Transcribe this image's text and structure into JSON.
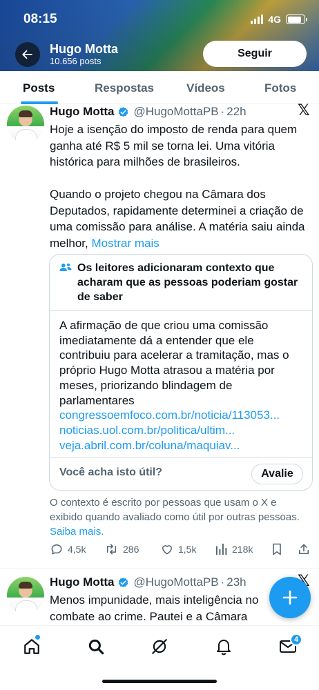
{
  "status_bar": {
    "time": "08:15",
    "network": "4G"
  },
  "profile_header": {
    "name": "Hugo Motta",
    "posts_count": "10.656 posts",
    "follow_label": "Seguir"
  },
  "tabs": [
    {
      "label": "Posts",
      "active": true
    },
    {
      "label": "Respostas",
      "active": false
    },
    {
      "label": "Vídeos",
      "active": false
    },
    {
      "label": "Fotos",
      "active": false
    }
  ],
  "tweet1": {
    "author": "Hugo Motta",
    "handle": "@HugoMottaPB",
    "time": "22h",
    "text_p1": "Hoje a isenção do imposto de renda para quem ganha até R$ 5 mil se torna lei. Uma vitória histórica para milhões de brasileiros.",
    "text_p2": "Quando o projeto chegou na Câmara dos Deputados, rapidamente determinei a criação de uma comissão para análise. A matéria saiu ainda melhor,",
    "show_more": "Mostrar mais",
    "note": {
      "title": "Os leitores adicionaram contexto que acharam que as pessoas poderiam gostar de saber",
      "body": "A afirmação de que criou uma comissão imediatamente dá a entender que ele contribuiu para acelerar a tramitação, mas o próprio Hugo Motta atrasou a matéria por meses, priorizando blindagem de parlamentares",
      "links": [
        "congressoemfoco.com.br/noticia/113053...",
        "noticias.uol.com.br/politica/ultim...",
        "veja.abril.com.br/coluna/maquiav..."
      ],
      "question": "Você acha isto útil?",
      "rate_label": "Avalie"
    },
    "disclaimer": "O contexto é escrito por pessoas que usam o X e exibido quando avaliado como útil por outras pessoas.",
    "learn_more": "Saiba mais.",
    "stats": {
      "replies": "4,5k",
      "reposts": "286",
      "likes": "1,5k",
      "views": "218k"
    }
  },
  "tweet2": {
    "author": "Hugo Motta",
    "handle": "@HugoMottaPB",
    "time": "23h",
    "text": "Menos impunidade, mais inteligência no combate ao crime. Pautei e a Câmara aprovou"
  },
  "bottom_nav": {
    "messages_badge": "4"
  },
  "colors": {
    "accent": "#1d9bf0",
    "text_primary": "#0f1419",
    "text_secondary": "#536471",
    "border": "#cfd9de"
  },
  "icons": {
    "back": "arrow-left-icon",
    "verified": "verified-badge-icon",
    "x_logo": "x-logo-icon",
    "note": "people-icon",
    "reply": "comment-icon",
    "repost": "repost-icon",
    "like": "heart-icon",
    "views": "bar-chart-icon",
    "bookmark": "bookmark-icon",
    "share": "share-icon",
    "compose": "plus-icon",
    "home": "home-icon",
    "search": "search-icon",
    "grok": "grok-icon",
    "notifications": "bell-icon",
    "messages": "envelope-icon"
  }
}
